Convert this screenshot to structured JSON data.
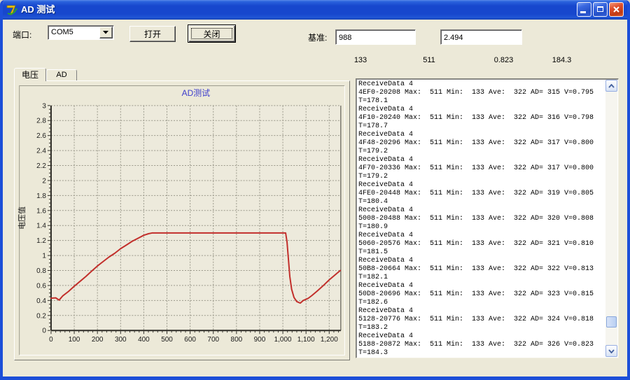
{
  "window": {
    "title": "AD 测试"
  },
  "icons": {
    "app": "app-logo-icon",
    "minimize": "minimize-icon",
    "maximize": "maximize-icon",
    "close": "close-x-icon",
    "combo_arrow": "chevron-down-icon",
    "scroll_up": "chevron-up-icon",
    "scroll_down": "chevron-down-icon"
  },
  "toolbar": {
    "port_label": "端口:",
    "port_value": "COM5",
    "open_button": "打开",
    "close_button": "关闭",
    "baseline_label": "基准:",
    "baseline_ad_value": "988",
    "baseline_v_value": "2.494"
  },
  "stats": {
    "values": [
      "133",
      "511",
      "0.823",
      "184.3"
    ]
  },
  "tabs": [
    {
      "label": "电压",
      "active": true
    },
    {
      "label": "AD",
      "active": false
    }
  ],
  "chart_data": {
    "type": "line",
    "title": "AD测试",
    "xlabel": "",
    "ylabel": "电压值",
    "xlim": [
      0,
      1250
    ],
    "ylim": [
      0,
      3
    ],
    "x_tick_step": 100,
    "x_minor_step": 20,
    "y_tick_step": 0.2,
    "y_minor_step": 0.05,
    "grid": true,
    "legend": "none",
    "line_color": "#c22f2b",
    "series": [
      {
        "name": "电压",
        "points": [
          [
            0,
            0.43
          ],
          [
            20,
            0.435
          ],
          [
            35,
            0.405
          ],
          [
            50,
            0.46
          ],
          [
            75,
            0.52
          ],
          [
            100,
            0.59
          ],
          [
            125,
            0.655
          ],
          [
            150,
            0.72
          ],
          [
            175,
            0.79
          ],
          [
            200,
            0.86
          ],
          [
            225,
            0.92
          ],
          [
            250,
            0.98
          ],
          [
            275,
            1.03
          ],
          [
            300,
            1.09
          ],
          [
            325,
            1.14
          ],
          [
            350,
            1.19
          ],
          [
            375,
            1.23
          ],
          [
            400,
            1.27
          ],
          [
            420,
            1.29
          ],
          [
            435,
            1.3
          ],
          [
            500,
            1.3
          ],
          [
            600,
            1.3
          ],
          [
            700,
            1.3
          ],
          [
            800,
            1.3
          ],
          [
            900,
            1.3
          ],
          [
            1000,
            1.3
          ],
          [
            1012,
            1.3
          ],
          [
            1018,
            1.18
          ],
          [
            1024,
            0.95
          ],
          [
            1030,
            0.72
          ],
          [
            1038,
            0.55
          ],
          [
            1048,
            0.44
          ],
          [
            1060,
            0.385
          ],
          [
            1075,
            0.365
          ],
          [
            1088,
            0.4
          ],
          [
            1100,
            0.415
          ],
          [
            1110,
            0.43
          ],
          [
            1125,
            0.465
          ],
          [
            1150,
            0.53
          ],
          [
            1175,
            0.6
          ],
          [
            1200,
            0.675
          ],
          [
            1225,
            0.74
          ],
          [
            1248,
            0.8
          ]
        ]
      }
    ]
  },
  "log": {
    "lines": [
      "ReceiveData 4",
      "4EF0-20208 Max:  511 Min:  133 Ave:  322 AD= 315 V=0.795",
      "T=178.1",
      "ReceiveData 4",
      "4F10-20240 Max:  511 Min:  133 Ave:  322 AD= 316 V=0.798",
      "T=178.7",
      "ReceiveData 4",
      "4F48-20296 Max:  511 Min:  133 Ave:  322 AD= 317 V=0.800",
      "T=179.2",
      "ReceiveData 4",
      "4F70-20336 Max:  511 Min:  133 Ave:  322 AD= 317 V=0.800",
      "T=179.2",
      "ReceiveData 4",
      "4FE0-20448 Max:  511 Min:  133 Ave:  322 AD= 319 V=0.805",
      "T=180.4",
      "ReceiveData 4",
      "5008-20488 Max:  511 Min:  133 Ave:  322 AD= 320 V=0.808",
      "T=180.9",
      "ReceiveData 4",
      "5060-20576 Max:  511 Min:  133 Ave:  322 AD= 321 V=0.810",
      "T=181.5",
      "ReceiveData 4",
      "50B8-20664 Max:  511 Min:  133 Ave:  322 AD= 322 V=0.813",
      "T=182.1",
      "ReceiveData 4",
      "50D8-20696 Max:  511 Min:  133 Ave:  322 AD= 323 V=0.815",
      "T=182.6",
      "ReceiveData 4",
      "5128-20776 Max:  511 Min:  133 Ave:  322 AD= 324 V=0.818",
      "T=183.2",
      "ReceiveData 4",
      "5188-20872 Max:  511 Min:  133 Ave:  322 AD= 326 V=0.823",
      "T=184.3"
    ]
  },
  "colors": {
    "titlebar_blue": "#1b4dd3",
    "window_bg": "#ECE9D8",
    "chart_title": "#3b3bcc",
    "curve_red": "#c22f2b",
    "grid_gray": "#9a988a",
    "listbox_bg": "#ffffff"
  }
}
